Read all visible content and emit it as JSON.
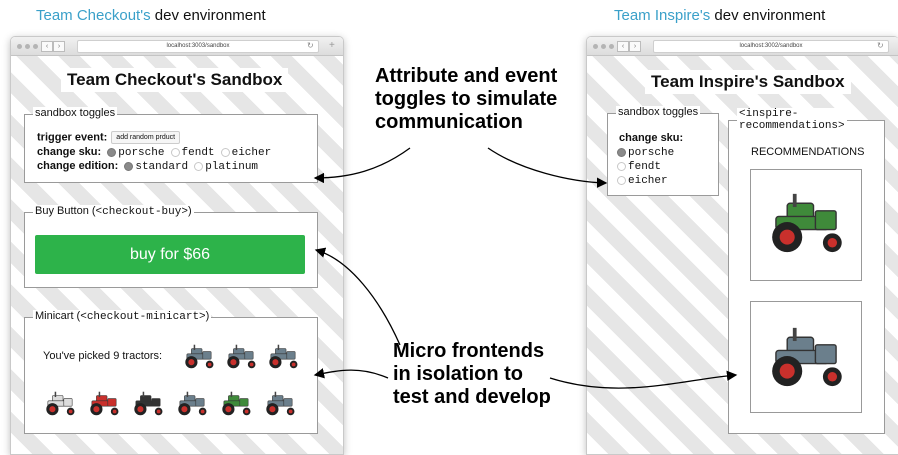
{
  "captions": {
    "left": {
      "team": "Team Checkout's",
      "rest": " dev environment"
    },
    "right": {
      "team": "Team Inspire's",
      "rest": " dev environment"
    }
  },
  "left_window": {
    "url": "localhost:3003/sandbox",
    "title": "Team Checkout's Sandbox",
    "toggles": {
      "legend": "sandbox toggles",
      "trigger_label": "trigger event:",
      "trigger_button": "add random prduct",
      "sku_label": "change sku:",
      "sku_options": [
        "porsche",
        "fendt",
        "eicher"
      ],
      "edition_label": "change edition:",
      "edition_options": [
        "standard",
        "platinum"
      ]
    },
    "buy": {
      "legend_prefix": "Buy Button (",
      "legend_tag": "<checkout-buy>",
      "legend_suffix": ")",
      "button_label": "buy for $66"
    },
    "minicart": {
      "legend_prefix": "Minicart (",
      "legend_tag": "<checkout-minicart>",
      "legend_suffix": ")",
      "text": "You've picked 9 tractors:"
    }
  },
  "right_window": {
    "url": "localhost:3002/sandbox",
    "title": "Team Inspire's Sandbox",
    "toggles": {
      "legend": "sandbox toggles",
      "sku_label": "change sku:",
      "sku_options": [
        "porsche",
        "fendt",
        "eicher"
      ]
    },
    "recommendations": {
      "legend_line1": "<inspire-",
      "legend_line2": "recommendations>",
      "heading": "RECOMMENDATIONS"
    }
  },
  "annotations": {
    "top": [
      "Attribute and event",
      "toggles to simulate",
      "communication"
    ],
    "bottom": [
      "Micro frontends",
      "in isolation to",
      "test and develop"
    ]
  },
  "colors": {
    "caption_accent": "#3aa0c9",
    "buy_button": "#2db34a",
    "tractor_blue": "#6b7f8c",
    "tractor_red": "#c9302c",
    "tractor_green": "#3f8a3a",
    "tractor_white": "#dcdcdc",
    "tractor_black": "#333333"
  },
  "tractor_icons": {
    "minicart_top": [
      "blue",
      "blue",
      "blue"
    ],
    "minicart_bottom": [
      "white",
      "red",
      "black",
      "blue",
      "green",
      "blue"
    ],
    "recommendations": [
      "green",
      "blue"
    ]
  }
}
